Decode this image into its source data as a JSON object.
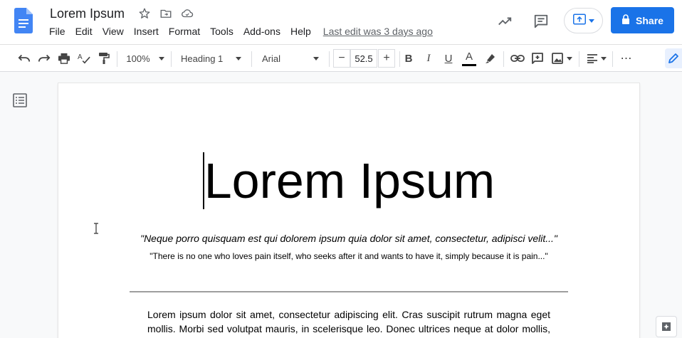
{
  "header": {
    "title": "Lorem Ipsum",
    "menu": [
      "File",
      "Edit",
      "View",
      "Insert",
      "Format",
      "Tools",
      "Add-ons",
      "Help"
    ],
    "last_edit": "Last edit was 3 days ago",
    "share_label": "Share",
    "icons": [
      "docs-logo-icon",
      "star-icon",
      "move-to-folder-icon",
      "cloud-saved-icon",
      "activity-trend-icon",
      "comments-icon",
      "present-icon"
    ]
  },
  "toolbar": {
    "zoom": "100%",
    "style": "Heading 1",
    "font": "Arial",
    "font_size": "52.5",
    "minus": "−",
    "plus": "+",
    "bold": "B",
    "italic": "I",
    "underline": "U",
    "text_color_label": "A",
    "text_color": "#000000",
    "more": "⋯"
  },
  "document": {
    "heading": "Lorem Ipsum",
    "quote_latin": "\"Neque porro quisquam est qui dolorem ipsum quia dolor sit amet, consectetur, adipisci velit...\"",
    "quote_english": "\"There is no one who loves pain itself, who seeks after it and wants to have it, simply because it is pain...\"",
    "body": "Lorem ipsum dolor sit amet, consectetur adipiscing elit. Cras suscipit rutrum magna eget mollis. Morbi sed volutpat mauris, in scelerisque leo. Donec ultrices neque at dolor mollis, ut sollicitudin nisi fringilla. Integer at massa id mi vehicula placerat."
  },
  "colors": {
    "brand_blue": "#1a73e8",
    "docs_blue": "#4285f4"
  }
}
